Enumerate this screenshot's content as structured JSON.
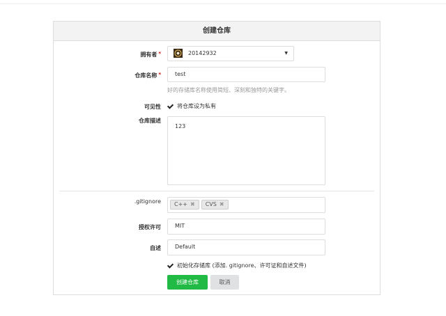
{
  "title": "创建仓库",
  "owner": {
    "label": "拥有者",
    "value": "20142932"
  },
  "repo_name": {
    "label": "仓库名称",
    "value": "test",
    "help": "好的存储库名称使用简短、深刻和独特的关键字。"
  },
  "visibility": {
    "label": "可见性",
    "checkbox": "将仓库设为私有"
  },
  "description": {
    "label": "仓库描述",
    "value": "123"
  },
  "gitignore": {
    "label": ".gitignore",
    "tags": [
      "C++",
      "CVS"
    ]
  },
  "license": {
    "label": "授权许可",
    "value": "MIT"
  },
  "readme": {
    "label": "自述",
    "value": "Default"
  },
  "init": {
    "checkbox": "初始化存储库 (添加. gitignore、许可证和自述文件)"
  },
  "buttons": {
    "create": "创建仓库",
    "cancel": "取消"
  },
  "colors": {
    "primary": "#21ba45"
  }
}
